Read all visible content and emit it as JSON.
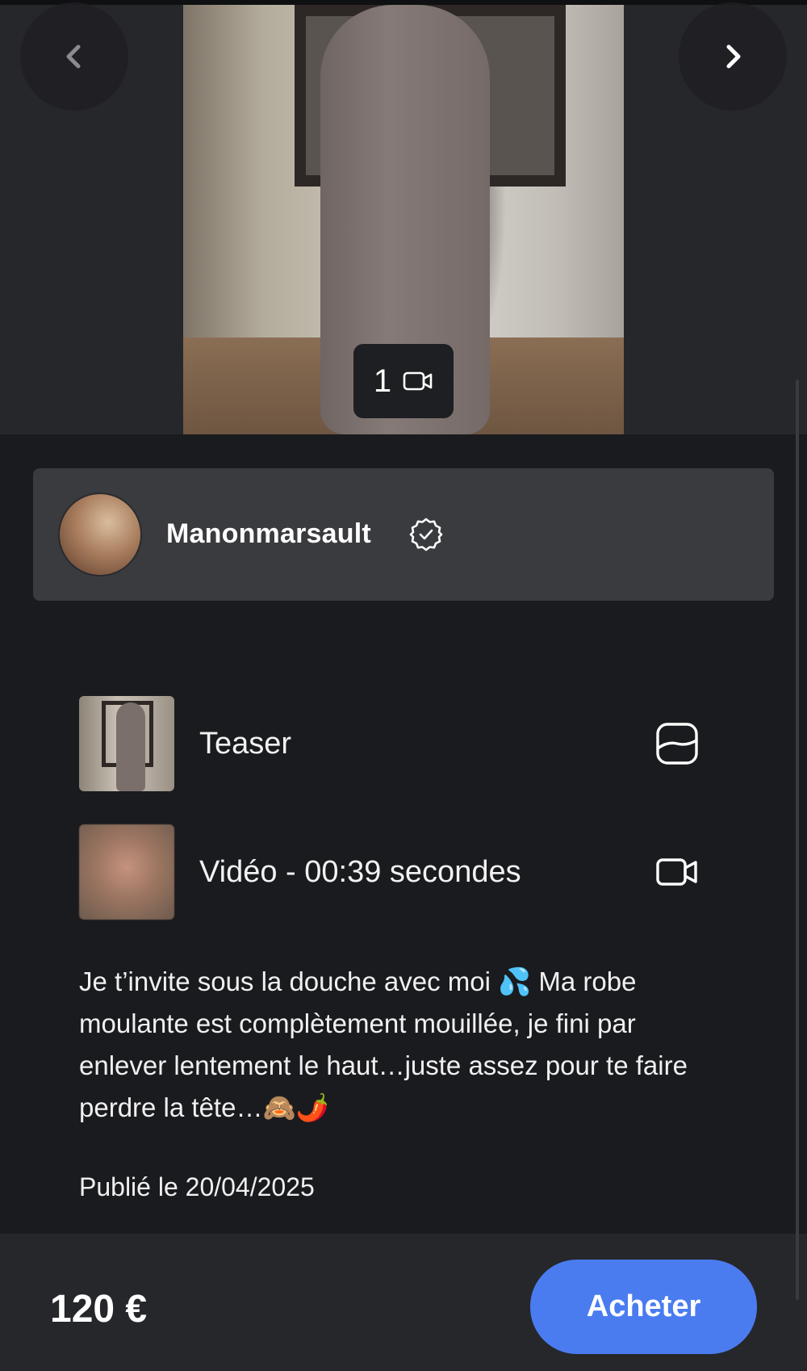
{
  "hero": {
    "media_count": "1",
    "media_icon": "video-camera-icon",
    "prev_icon": "chevron-left-icon",
    "next_icon": "chevron-right-icon"
  },
  "creator": {
    "name": "Manonmarsault",
    "verified_icon": "verified-badge-icon"
  },
  "content_items": [
    {
      "label": "Teaser",
      "icon": "image-icon"
    },
    {
      "label": "Vidéo - 00:39 secondes",
      "icon": "video-camera-icon"
    }
  ],
  "description": "Je t’invite sous la douche avec moi 💦 Ma robe moulante est complètement mouillée, je fini par enlever lentement le haut…juste assez pour te faire perdre la tête…🙈🌶️",
  "published": "Publié le 20/04/2025",
  "purchase": {
    "price": "120 €",
    "button_label": "Acheter",
    "accent_color": "#4a7cf0"
  },
  "colors": {
    "background": "#1a1b1f",
    "card": "#3a3b3f",
    "bottom_bar": "#26272b"
  }
}
